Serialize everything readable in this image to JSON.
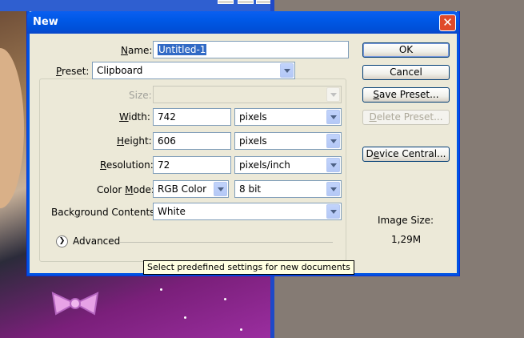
{
  "dialog": {
    "title": "New",
    "close_icon": "close-icon"
  },
  "form": {
    "name_label": "Name:",
    "name_value": "Untitled-1",
    "preset_label": "Preset:",
    "preset_value": "Clipboard",
    "size_label": "Size:",
    "size_value": "",
    "width_label": "Width:",
    "width_value": "742",
    "width_unit": "pixels",
    "height_label": "Height:",
    "height_value": "606",
    "height_unit": "pixels",
    "resolution_label": "Resolution:",
    "resolution_value": "72",
    "resolution_unit": "pixels/inch",
    "color_mode_label": "Color Mode:",
    "color_mode_value": "RGB Color",
    "bit_depth_value": "8 bit",
    "background_label": "Background Contents:",
    "background_value": "White",
    "advanced_label": "Advanced"
  },
  "buttons": {
    "ok": "OK",
    "cancel": "Cancel",
    "save_preset": "Save Preset...",
    "delete_preset": "Delete Preset...",
    "device_central": "Device Central..."
  },
  "info": {
    "image_size_label": "Image Size:",
    "image_size_value": "1,29M"
  },
  "tooltip": "Select predefined settings for new documents",
  "colors": {
    "titlebar": "#0058e6",
    "dialog_bg": "#ece9d8",
    "selection": "#316ac5"
  }
}
